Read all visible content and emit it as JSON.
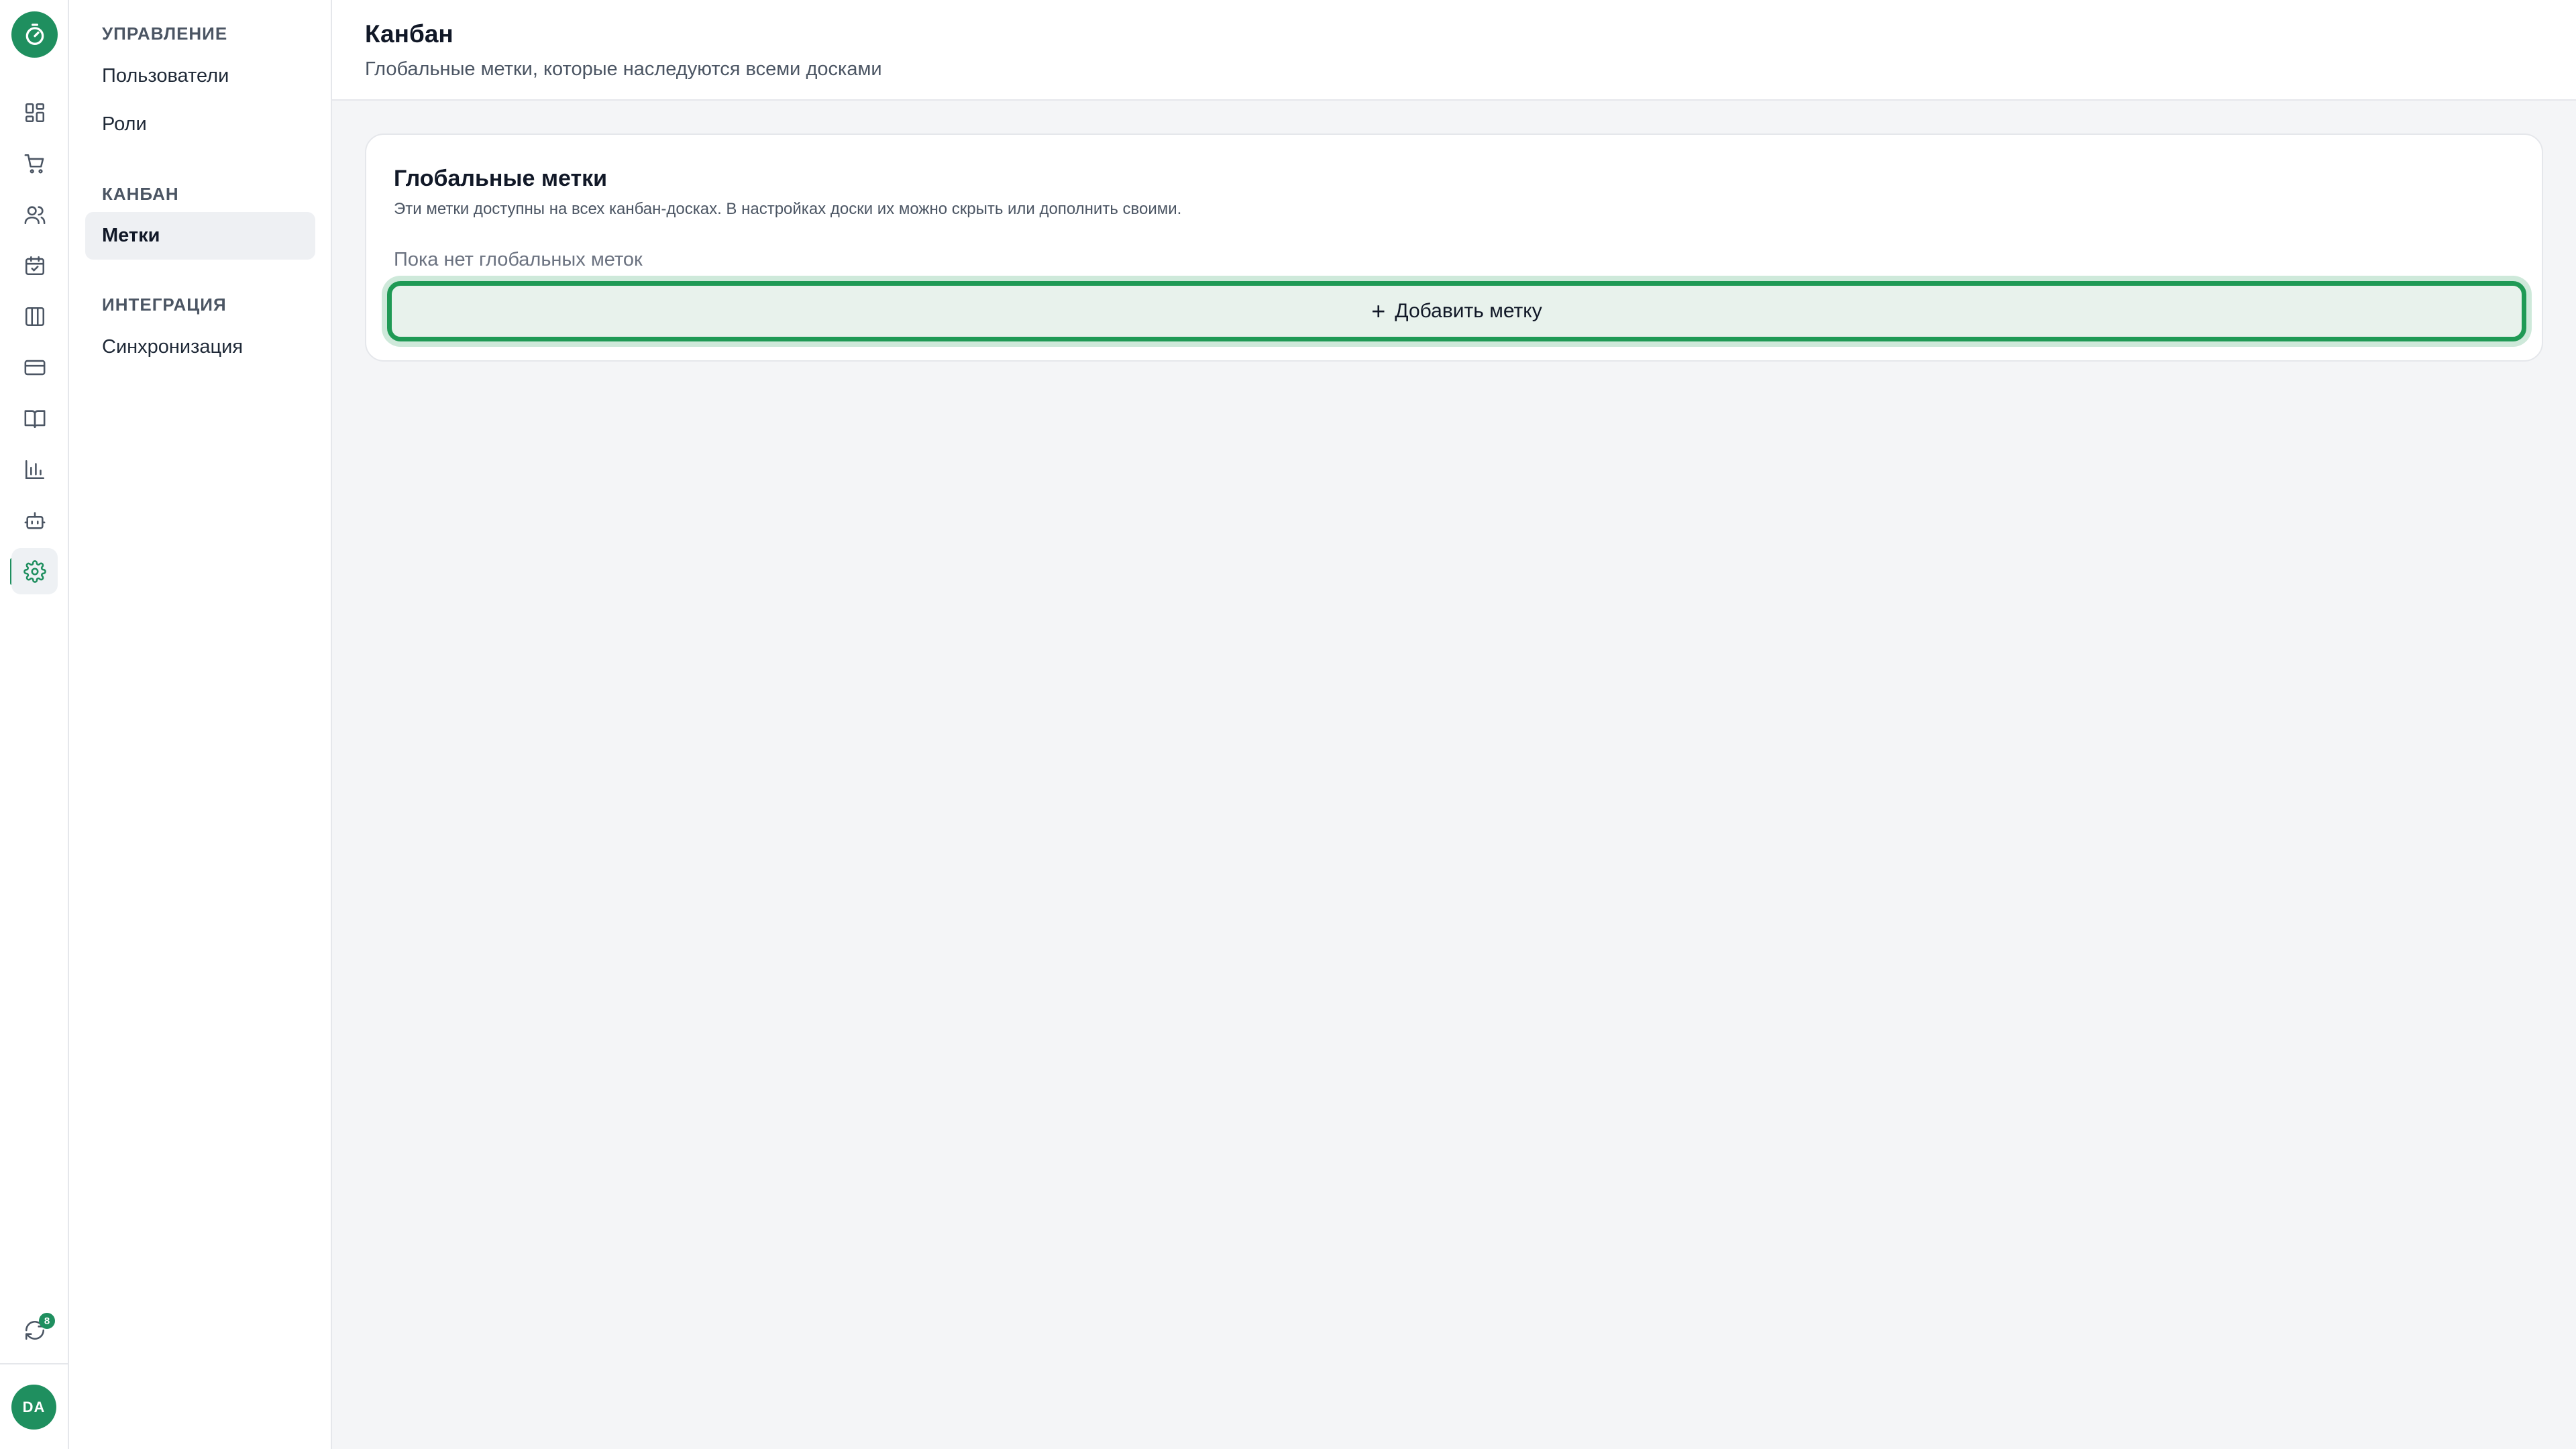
{
  "rail": {
    "icons": [
      "stopwatch-icon",
      "dashboard-icon",
      "cart-icon",
      "users-icon",
      "calendar-check-icon",
      "kanban-icon",
      "card-icon",
      "book-icon",
      "chart-icon",
      "bot-icon",
      "gear-icon"
    ],
    "sync_badge": "8",
    "avatar_initials": "DA"
  },
  "sidebar": {
    "sections": [
      {
        "title": "УПРАВЛЕНИЕ",
        "items": [
          "Пользователи",
          "Роли"
        ]
      },
      {
        "title": "КАНБАН",
        "items": [
          "Метки"
        ]
      },
      {
        "title": "ИНТЕГРАЦИЯ",
        "items": [
          "Синхронизация"
        ]
      }
    ],
    "active_item": "Метки"
  },
  "header": {
    "title": "Канбан",
    "subtitle": "Глобальные метки, которые наследуются всеми досками"
  },
  "card": {
    "title": "Глобальные метки",
    "description": "Эти метки доступны на всех канбан-досках. В настройках доски их можно скрыть или дополнить своими.",
    "empty_text": "Пока нет глобальных меток",
    "add_button": "Добавить метку"
  },
  "colors": {
    "accent": "#1f8f5f",
    "focus_ring": "#1f9a55",
    "background": "#f4f5f7"
  }
}
